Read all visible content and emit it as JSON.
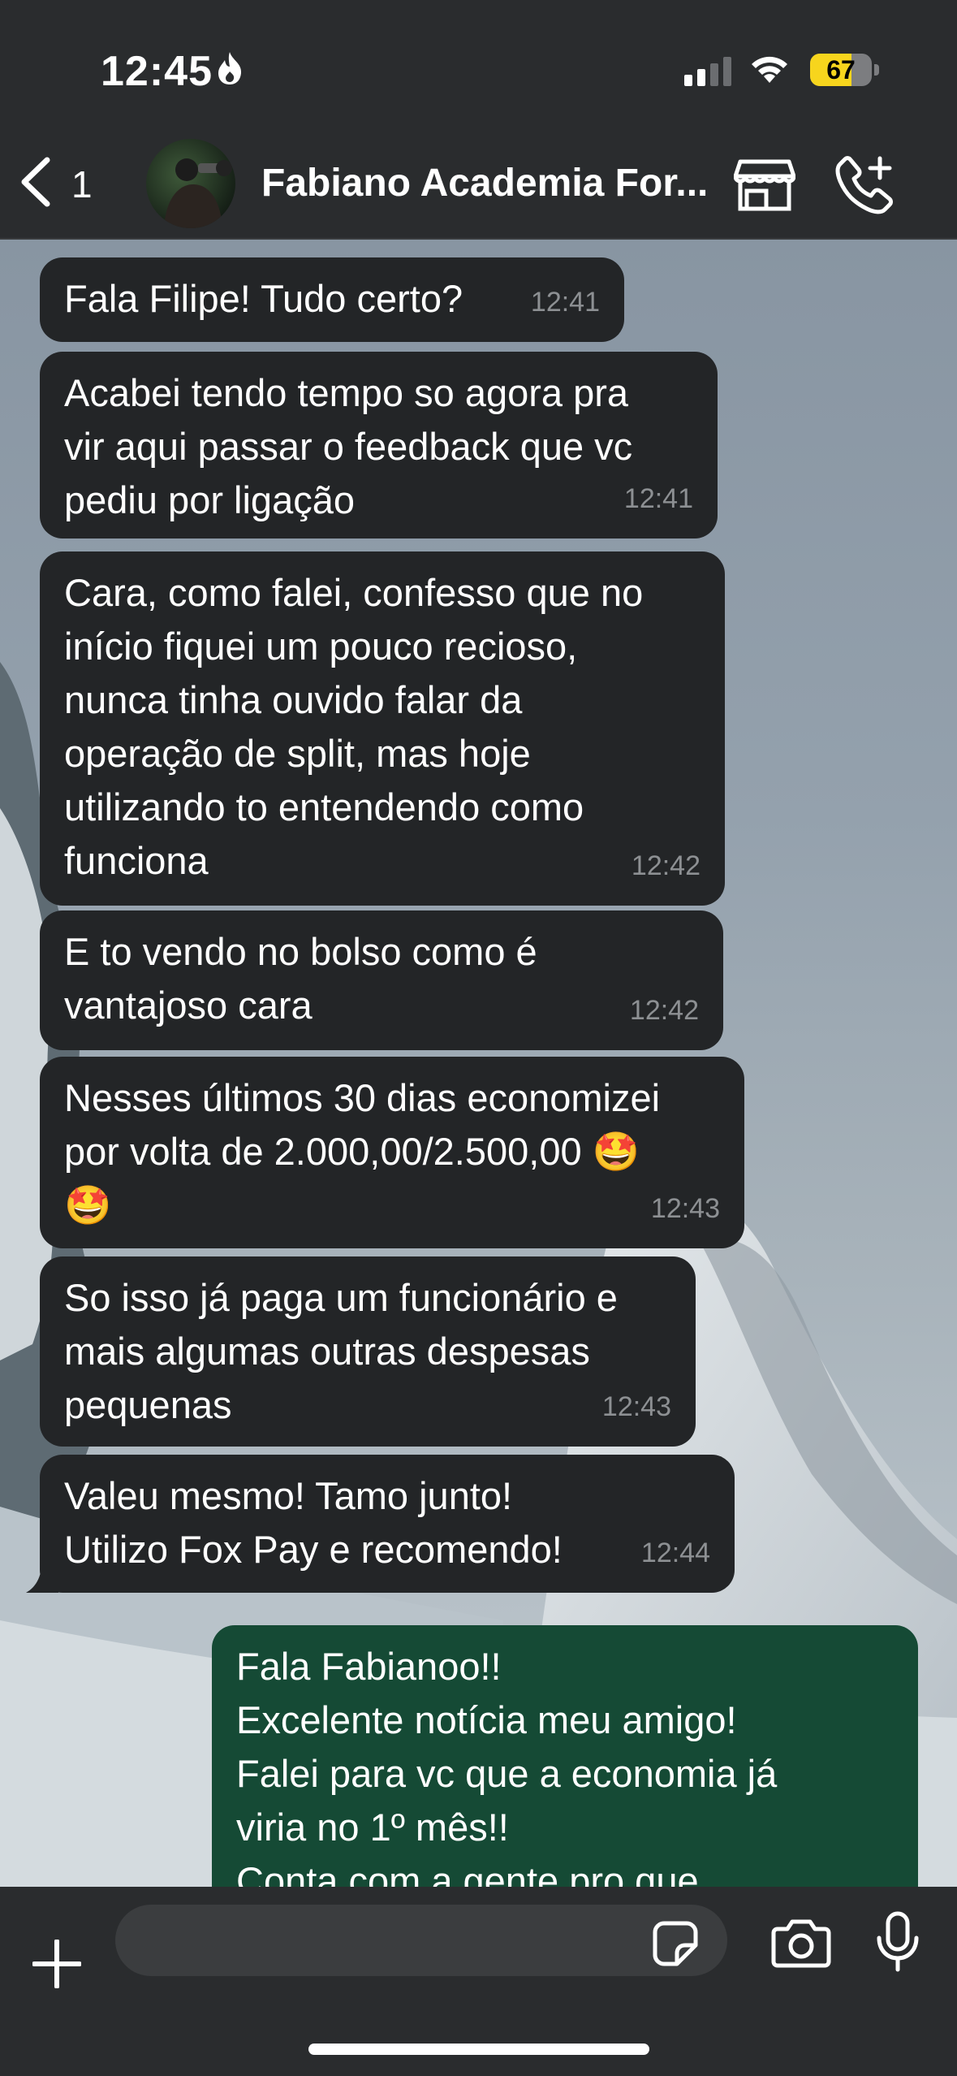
{
  "status_bar": {
    "time": "12:45",
    "battery": "67"
  },
  "header": {
    "back_count": "1",
    "contact_name": "Fabiano Academia For..."
  },
  "messages": [
    {
      "text": "Fala Filipe! Tudo certo?",
      "time": "12:41",
      "direction": "in"
    },
    {
      "text": "Acabei tendo tempo so agora pra\nvir aqui passar o feedback que vc\npediu por ligação",
      "time": "12:41",
      "direction": "in"
    },
    {
      "text": "Cara, como falei, confesso que no\ninício fiquei um pouco recioso,\nnunca tinha ouvido falar da\noperação de split, mas hoje\nutilizando to entendendo como\nfunciona",
      "time": "12:42",
      "direction": "in"
    },
    {
      "text": "E to vendo no bolso como é\nvantajoso cara",
      "time": "12:42",
      "direction": "in"
    },
    {
      "text": "Nesses últimos 30 dias economizei\npor volta de 2.000,00/2.500,00 🤩\n🤩",
      "time": "12:43",
      "direction": "in"
    },
    {
      "text": "So isso já paga um funcionário e\nmais algumas outras despesas\npequenas",
      "time": "12:43",
      "direction": "in"
    },
    {
      "text": "Valeu mesmo! Tamo junto!\nUtilizo Fox Pay e recomendo!",
      "time": "12:44",
      "direction": "in"
    },
    {
      "text": "Fala Fabianoo!!\nExcelente notícia meu amigo!\nFalei para vc que a economia já\nviria no 1º mês!!\nConta com a gente pro que",
      "direction": "out"
    }
  ],
  "composer": {
    "placeholder": ""
  },
  "colors": {
    "incoming_bubble": "#232527",
    "outgoing_bubble": "#154a35",
    "battery_accent": "#f7d51d"
  }
}
